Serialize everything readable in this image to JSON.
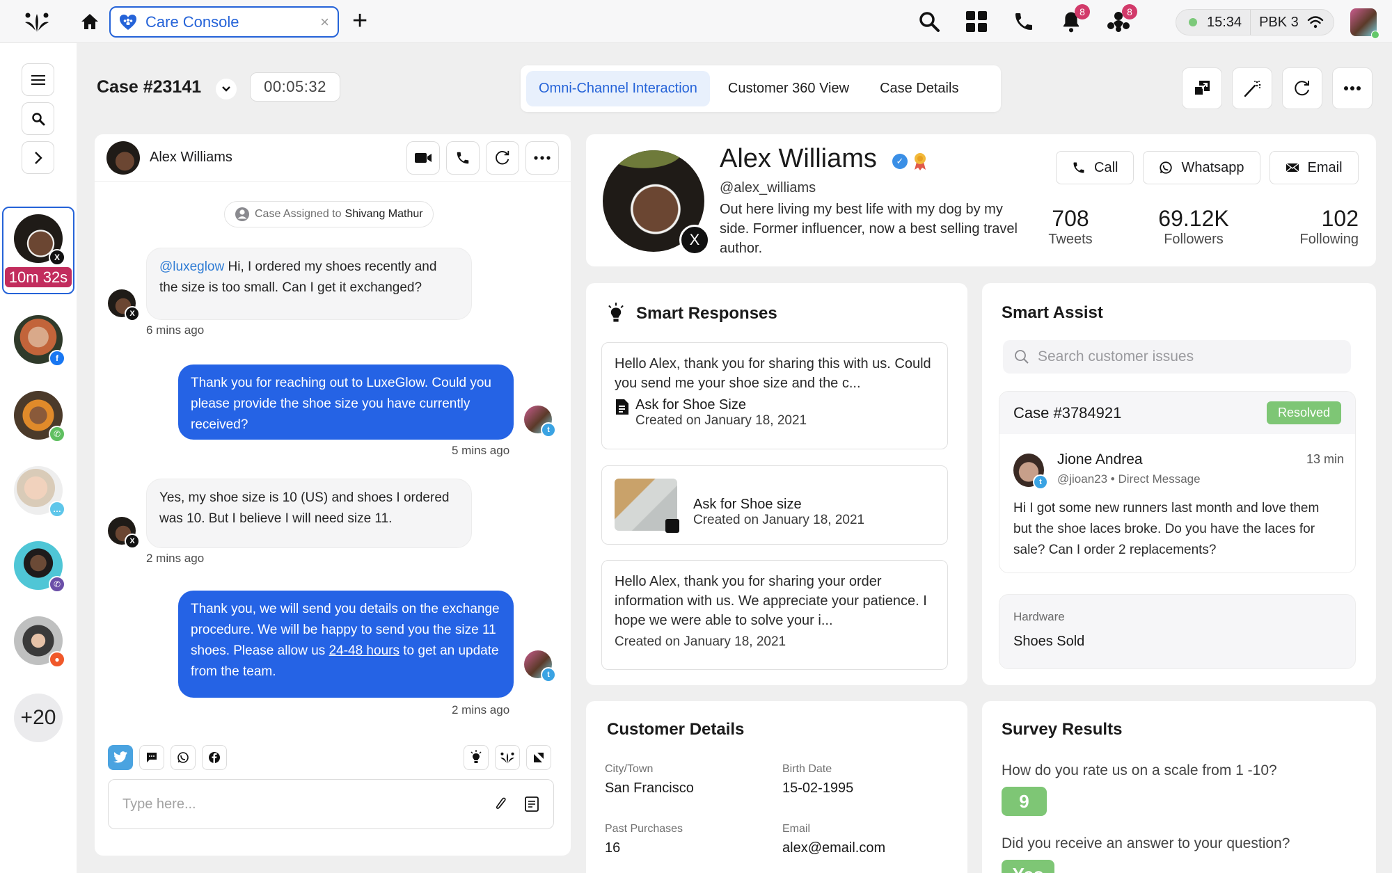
{
  "topbar": {
    "tab_label": "Care Console",
    "tab_close": "×",
    "add_tab": "+",
    "notifications_count": "8",
    "team_count": "8",
    "clock": "15:34",
    "station": "PBK 3"
  },
  "rail": {
    "active_timer": "10m 32s",
    "more_count": "+20",
    "conversations": [
      {
        "channel": "x"
      },
      {
        "channel": "facebook"
      },
      {
        "channel": "phone"
      },
      {
        "channel": "chat"
      },
      {
        "channel": "viber"
      },
      {
        "channel": "reddit"
      }
    ]
  },
  "header": {
    "case_title": "Case #23141",
    "timer": "00:05:32",
    "tabs": [
      {
        "label": "Omni-Channel Interaction",
        "active": true
      },
      {
        "label": "Customer 360 View",
        "active": false
      },
      {
        "label": "Case Details",
        "active": false
      }
    ]
  },
  "chat": {
    "contact_name": "Alex Williams",
    "assigned_prefix": "Case Assigned to",
    "assigned_to": "Shivang Mathur",
    "messages": [
      {
        "direction": "in",
        "mention": "@luxeglow",
        "text": " Hi, I ordered my shoes recently and the size is too small. Can I get it exchanged?",
        "time": "6 mins ago"
      },
      {
        "direction": "out",
        "text": "Thank you for reaching out to LuxeGlow. Could you please provide the shoe size you have currently received?",
        "time": "5 mins ago"
      },
      {
        "direction": "in",
        "text": "Yes, my shoe size is 10 (US) and shoes I ordered was 10. But I believe I will need size 11.",
        "time": "2 mins ago"
      },
      {
        "direction": "out",
        "text_before": "Thank you, we will send you details on the exchange procedure. We will be happy to send you the size 11 shoes. Please allow us ",
        "link": "24-48 hours",
        "text_after": " to get an update from the team.",
        "time": "2 mins ago"
      }
    ],
    "composer_placeholder": "Type here..."
  },
  "profile": {
    "name": "Alex Williams",
    "handle": "@alex_williams",
    "bio": "Out here living my best life with my dog by my side. Former influencer, now a best selling travel author.",
    "buttons": {
      "call": "Call",
      "whatsapp": "Whatsapp",
      "email": "Email"
    },
    "stats": [
      {
        "value": "708",
        "label": "Tweets"
      },
      {
        "value": "69.12K",
        "label": "Followers"
      },
      {
        "value": "102",
        "label": "Following"
      }
    ]
  },
  "smart_responses": {
    "title": "Smart Responses",
    "items": [
      {
        "text": "Hello Alex, thank you for sharing this with us. Could you send me your shoe size and the c...",
        "template": "Ask for Shoe Size",
        "created": "Created on January 18, 2021"
      },
      {
        "template": "Ask for Shoe size",
        "created": "Created on January 18, 2021"
      },
      {
        "text": "Hello Alex, thank you for sharing your order information with us. We appreciate your patience. I hope we were able to solve your i...",
        "created": "Created on January 18, 2021"
      }
    ]
  },
  "smart_assist": {
    "title": "Smart Assist",
    "search_placeholder": "Search customer issues",
    "case": {
      "title": "Case #3784921",
      "status": "Resolved",
      "author": "Jione Andrea",
      "meta": "@jioan23 • Direct Message",
      "time": "13 min",
      "text": "Hi I got some new runners last month and love them but the shoe laces broke. Do you have the laces for sale? Can I order 2 replacements?"
    },
    "category_label": "Hardware",
    "category_value": "Shoes Sold"
  },
  "customer_details": {
    "title": "Customer Details",
    "fields": [
      {
        "label": "City/Town",
        "value": "San Francisco"
      },
      {
        "label": "Birth Date",
        "value": "15-02-1995"
      },
      {
        "label": "Past Purchases",
        "value": "16"
      },
      {
        "label": "Email",
        "value": "alex@email.com"
      }
    ]
  },
  "survey": {
    "title": "Survey Results",
    "questions": [
      {
        "question": "How do you rate us on a scale from 1 -10?",
        "answer": "9"
      },
      {
        "question": "Did you receive an answer to your question?",
        "answer": "Yes"
      }
    ]
  },
  "colors": {
    "accent": "#2563d8",
    "outgoing_bubble": "#2563e5",
    "success": "#7ec675",
    "timer_badge": "#c22c5d",
    "notification": "#d23a6a"
  }
}
